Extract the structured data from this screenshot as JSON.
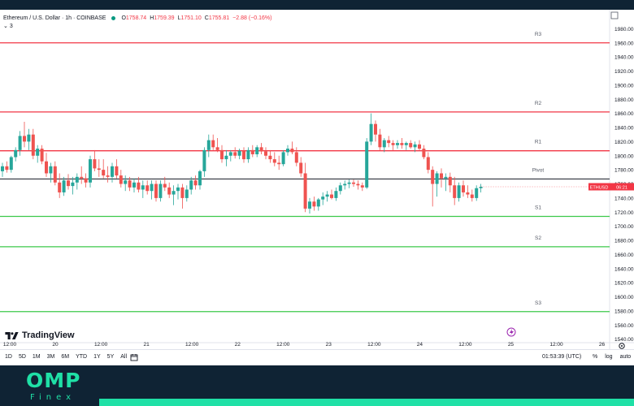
{
  "legend": {
    "title": "Ethereum / U.S. Dollar · 1h · COINBASE",
    "o_label": "O",
    "o_val": "1758.74",
    "h_label": "H",
    "h_val": "1759.39",
    "l_label": "L",
    "l_val": "1751.10",
    "c_label": "C",
    "c_val": "1755.81",
    "change": "−2.88 (−0.16%)",
    "indicator_count": "3"
  },
  "colors": {
    "up": "#26a69a",
    "down": "#ef5350",
    "resistance": "#f23645",
    "support": "#3cc94a",
    "pivot": "#131722",
    "price_label_bg": "#f23645"
  },
  "chart_data": {
    "type": "candlestick",
    "symbol": "ETHUSD",
    "last_price_label": "ETHUSD",
    "last_price_countdown": "06:21",
    "ylim": [
      1535,
      2000
    ],
    "y_ticks": [
      1540,
      1560,
      1580,
      1600,
      1620,
      1640,
      1660,
      1680,
      1700,
      1720,
      1740,
      1760,
      1780,
      1800,
      1820,
      1840,
      1860,
      1880,
      1900,
      1920,
      1940,
      1960,
      1980
    ],
    "y_tick_labels": [
      "1540.00",
      "1560.00",
      "1580.00",
      "1600.00",
      "1620.00",
      "1640.00",
      "1660.00",
      "1680.00",
      "1700.00",
      "1720.00",
      "1740.00",
      "1760.00",
      "1780.00",
      "1800.00",
      "1820.00",
      "1840.00",
      "1860.00",
      "1880.00",
      "1900.00",
      "1920.00",
      "1940.00",
      "1960.00",
      "1980.00"
    ],
    "x_range": [
      0,
      130
    ],
    "x_ticks": [
      {
        "x": 0,
        "label": "12:00"
      },
      {
        "x": 12,
        "label": "20"
      },
      {
        "x": 24,
        "label": "12:00"
      },
      {
        "x": 36,
        "label": "21"
      },
      {
        "x": 48,
        "label": "12:00"
      },
      {
        "x": 60,
        "label": "22"
      },
      {
        "x": 72,
        "label": "12:00"
      },
      {
        "x": 84,
        "label": "23"
      },
      {
        "x": 96,
        "label": "12:00"
      },
      {
        "x": 108,
        "label": "24"
      },
      {
        "x": 120,
        "label": "12:00"
      },
      {
        "x": 132,
        "label": "25"
      },
      {
        "x": 144,
        "label": "12:00"
      },
      {
        "x": 156,
        "label": "26"
      }
    ],
    "levels": [
      {
        "name": "R3",
        "value": 1960,
        "kind": "resistance"
      },
      {
        "name": "R2",
        "value": 1862,
        "kind": "resistance"
      },
      {
        "name": "R1",
        "value": 1807,
        "kind": "resistance"
      },
      {
        "name": "Pivot",
        "value": 1767,
        "kind": "pivot"
      },
      {
        "name": "S1",
        "value": 1714,
        "kind": "support"
      },
      {
        "name": "S2",
        "value": 1671,
        "kind": "support"
      },
      {
        "name": "S3",
        "value": 1579,
        "kind": "support"
      }
    ],
    "candles": [
      [
        1778,
        1790,
        1770,
        1785
      ],
      [
        1785,
        1792,
        1776,
        1780
      ],
      [
        1780,
        1800,
        1776,
        1798
      ],
      [
        1798,
        1812,
        1792,
        1808
      ],
      [
        1808,
        1835,
        1800,
        1828
      ],
      [
        1828,
        1848,
        1812,
        1820
      ],
      [
        1820,
        1838,
        1808,
        1830
      ],
      [
        1830,
        1838,
        1795,
        1800
      ],
      [
        1800,
        1815,
        1790,
        1810
      ],
      [
        1810,
        1815,
        1788,
        1792
      ],
      [
        1792,
        1804,
        1770,
        1775
      ],
      [
        1775,
        1790,
        1762,
        1785
      ],
      [
        1785,
        1792,
        1758,
        1762
      ],
      [
        1762,
        1775,
        1740,
        1748
      ],
      [
        1748,
        1770,
        1743,
        1765
      ],
      [
        1765,
        1774,
        1752,
        1757
      ],
      [
        1757,
        1770,
        1745,
        1762
      ],
      [
        1762,
        1775,
        1752,
        1770
      ],
      [
        1770,
        1785,
        1760,
        1768
      ],
      [
        1768,
        1775,
        1755,
        1762
      ],
      [
        1762,
        1800,
        1755,
        1795
      ],
      [
        1795,
        1808,
        1778,
        1782
      ],
      [
        1782,
        1795,
        1770,
        1780
      ],
      [
        1780,
        1795,
        1768,
        1772
      ],
      [
        1772,
        1785,
        1762,
        1770
      ],
      [
        1770,
        1790,
        1762,
        1785
      ],
      [
        1785,
        1795,
        1768,
        1772
      ],
      [
        1772,
        1780,
        1755,
        1760
      ],
      [
        1760,
        1772,
        1750,
        1765
      ],
      [
        1765,
        1770,
        1750,
        1755
      ],
      [
        1755,
        1768,
        1748,
        1762
      ],
      [
        1762,
        1770,
        1748,
        1752
      ],
      [
        1752,
        1765,
        1740,
        1758
      ],
      [
        1758,
        1765,
        1745,
        1750
      ],
      [
        1750,
        1765,
        1738,
        1760
      ],
      [
        1760,
        1765,
        1735,
        1740
      ],
      [
        1740,
        1765,
        1735,
        1760
      ],
      [
        1760,
        1770,
        1750,
        1755
      ],
      [
        1755,
        1762,
        1740,
        1745
      ],
      [
        1745,
        1758,
        1730,
        1750
      ],
      [
        1750,
        1760,
        1738,
        1755
      ],
      [
        1755,
        1760,
        1725,
        1740
      ],
      [
        1740,
        1758,
        1735,
        1752
      ],
      [
        1752,
        1770,
        1745,
        1765
      ],
      [
        1765,
        1772,
        1752,
        1758
      ],
      [
        1758,
        1780,
        1752,
        1778
      ],
      [
        1778,
        1812,
        1770,
        1808
      ],
      [
        1808,
        1830,
        1798,
        1822
      ],
      [
        1822,
        1830,
        1808,
        1812
      ],
      [
        1812,
        1825,
        1805,
        1808
      ],
      [
        1808,
        1815,
        1790,
        1795
      ],
      [
        1795,
        1808,
        1785,
        1800
      ],
      [
        1800,
        1808,
        1792,
        1805
      ],
      [
        1805,
        1812,
        1796,
        1800
      ],
      [
        1800,
        1810,
        1795,
        1807
      ],
      [
        1807,
        1812,
        1790,
        1795
      ],
      [
        1795,
        1812,
        1790,
        1808
      ],
      [
        1808,
        1815,
        1798,
        1802
      ],
      [
        1802,
        1815,
        1798,
        1812
      ],
      [
        1812,
        1818,
        1802,
        1806
      ],
      [
        1806,
        1812,
        1795,
        1800
      ],
      [
        1800,
        1808,
        1790,
        1795
      ],
      [
        1795,
        1805,
        1785,
        1790
      ],
      [
        1790,
        1800,
        1780,
        1788
      ],
      [
        1788,
        1808,
        1785,
        1805
      ],
      [
        1805,
        1815,
        1800,
        1810
      ],
      [
        1810,
        1820,
        1802,
        1805
      ],
      [
        1805,
        1812,
        1785,
        1790
      ],
      [
        1790,
        1798,
        1770,
        1775
      ],
      [
        1775,
        1790,
        1720,
        1725
      ],
      [
        1725,
        1740,
        1718,
        1735
      ],
      [
        1735,
        1742,
        1722,
        1728
      ],
      [
        1728,
        1740,
        1722,
        1738
      ],
      [
        1738,
        1748,
        1730,
        1742
      ],
      [
        1742,
        1750,
        1735,
        1745
      ],
      [
        1745,
        1752,
        1738,
        1740
      ],
      [
        1740,
        1755,
        1736,
        1750
      ],
      [
        1750,
        1762,
        1745,
        1758
      ],
      [
        1758,
        1765,
        1752,
        1760
      ],
      [
        1760,
        1766,
        1754,
        1762
      ],
      [
        1762,
        1766,
        1756,
        1760
      ],
      [
        1760,
        1765,
        1752,
        1758
      ],
      [
        1758,
        1762,
        1750,
        1755
      ],
      [
        1755,
        1825,
        1753,
        1820
      ],
      [
        1820,
        1860,
        1815,
        1845
      ],
      [
        1845,
        1850,
        1820,
        1830
      ],
      [
        1830,
        1838,
        1808,
        1812
      ],
      [
        1812,
        1825,
        1805,
        1822
      ],
      [
        1822,
        1828,
        1812,
        1818
      ],
      [
        1818,
        1822,
        1808,
        1815
      ],
      [
        1815,
        1822,
        1810,
        1818
      ],
      [
        1818,
        1825,
        1810,
        1815
      ],
      [
        1815,
        1820,
        1808,
        1818
      ],
      [
        1818,
        1822,
        1810,
        1812
      ],
      [
        1812,
        1820,
        1805,
        1816
      ],
      [
        1816,
        1822,
        1808,
        1810
      ],
      [
        1810,
        1815,
        1795,
        1798
      ],
      [
        1798,
        1805,
        1775,
        1780
      ],
      [
        1780,
        1785,
        1728,
        1760
      ],
      [
        1760,
        1778,
        1742,
        1775
      ],
      [
        1775,
        1782,
        1755,
        1768
      ],
      [
        1768,
        1775,
        1750,
        1770
      ],
      [
        1770,
        1776,
        1748,
        1758
      ],
      [
        1758,
        1770,
        1730,
        1740
      ],
      [
        1740,
        1762,
        1735,
        1758
      ],
      [
        1758,
        1765,
        1742,
        1748
      ],
      [
        1748,
        1758,
        1740,
        1745
      ],
      [
        1745,
        1752,
        1735,
        1740
      ],
      [
        1740,
        1758,
        1736,
        1754
      ],
      [
        1754,
        1760,
        1748,
        1756
      ]
    ]
  },
  "toolbar": {
    "ranges": [
      "1D",
      "5D",
      "1M",
      "3M",
      "6M",
      "YTD",
      "1Y",
      "5Y",
      "All"
    ],
    "time": "01:53:39 (UTC)",
    "percent": "%",
    "log": "log",
    "auto": "auto"
  },
  "branding": {
    "tradingview": "TradingView",
    "omp": "OMP",
    "finex": "Finex"
  }
}
